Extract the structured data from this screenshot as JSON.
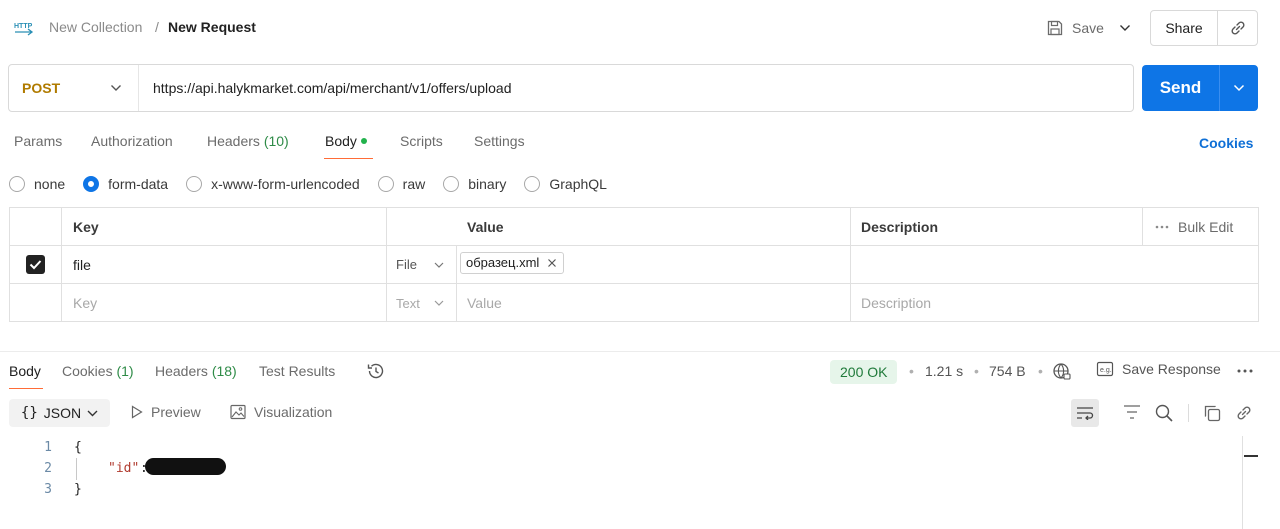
{
  "header": {
    "method_icon_label": "HTTP",
    "collection": "New Collection",
    "separator": "/",
    "request_name": "New Request",
    "save_label": "Save",
    "share_label": "Share"
  },
  "request": {
    "method": "POST",
    "url": "https://api.halykmarket.com/api/merchant/v1/offers/upload",
    "send_label": "Send"
  },
  "tabs": {
    "params": "Params",
    "authorization": "Authorization",
    "headers": "Headers",
    "headers_count": "(10)",
    "body": "Body",
    "scripts": "Scripts",
    "settings": "Settings",
    "cookies": "Cookies"
  },
  "body_modes": [
    {
      "label": "none",
      "selected": false
    },
    {
      "label": "form-data",
      "selected": true
    },
    {
      "label": "x-www-form-urlencoded",
      "selected": false
    },
    {
      "label": "raw",
      "selected": false
    },
    {
      "label": "binary",
      "selected": false
    },
    {
      "label": "GraphQL",
      "selected": false
    }
  ],
  "form_table": {
    "headers": {
      "key": "Key",
      "value": "Value",
      "description": "Description",
      "bulk_edit": "Bulk Edit"
    },
    "rows": [
      {
        "checked": true,
        "key": "file",
        "type": "File",
        "value": "образец.xml",
        "description": ""
      }
    ],
    "placeholder_row": {
      "key": "Key",
      "type": "Text",
      "value": "Value",
      "description": "Description"
    }
  },
  "response": {
    "tabs": {
      "body": "Body",
      "cookies": "Cookies",
      "cookies_count": "(1)",
      "headers": "Headers",
      "headers_count": "(18)",
      "test_results": "Test Results"
    },
    "status": "200 OK",
    "time": "1.21 s",
    "size": "754 B",
    "save_response": "Save Response",
    "format": "JSON",
    "preview": "Preview",
    "visualization": "Visualization",
    "lines": {
      "n1": "1",
      "n2": "2",
      "n3": "3",
      "open": "{",
      "key": "\"id\"",
      "colon": ":",
      "close": "}"
    }
  },
  "colors": {
    "accent": "#0e75e6",
    "method_post": "#b07b00",
    "tab_underline": "#ff6c37",
    "status_ok_bg": "#e6f5ea",
    "status_ok_text": "#1f7a3a"
  }
}
